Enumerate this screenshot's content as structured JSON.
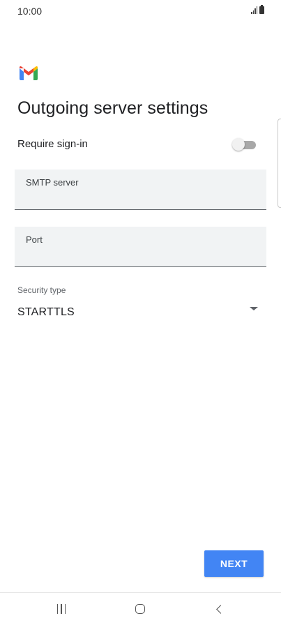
{
  "status_bar": {
    "time": "10:00",
    "signal_icon": "signal-bars-icon",
    "battery_icon": "battery-icon"
  },
  "app": {
    "logo_icon": "gmail-logo-icon",
    "colors": {
      "gmail_red": "#ea4335",
      "gmail_blue": "#4285f4",
      "gmail_green": "#34a853",
      "gmail_yellow": "#fbbc04",
      "accent": "#4285f4"
    }
  },
  "header": {
    "title": "Outgoing server settings"
  },
  "require_signin": {
    "label": "Require sign-in",
    "enabled": false
  },
  "fields": {
    "smtp_server": {
      "label": "SMTP server",
      "value": ""
    },
    "port": {
      "label": "Port",
      "value": ""
    }
  },
  "security": {
    "label": "Security type",
    "selected": "STARTTLS",
    "icon": "dropdown-arrow-icon"
  },
  "actions": {
    "next_label": "NEXT"
  },
  "nav_bar": {
    "recents_icon": "recents-icon",
    "home_icon": "home-icon",
    "back_icon": "back-icon"
  }
}
